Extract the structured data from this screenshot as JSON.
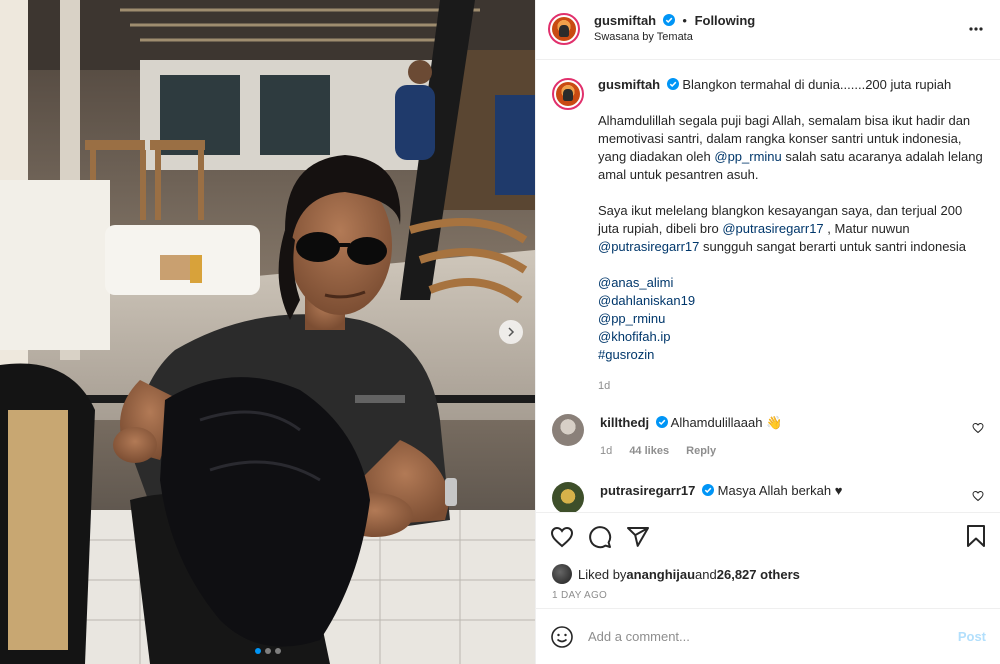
{
  "header": {
    "username": "gusmiftah",
    "separator": "•",
    "follow_status": "Following",
    "location": "Swasana by Temata",
    "more_icon": "more-horizontal-icon"
  },
  "caption": {
    "username": "gusmiftah",
    "title": "Blangkon termahal di dunia.......200 juta rupiah",
    "para1": "Alhamdulillah segala puji bagi Allah, semalam bisa ikut hadir dan memotivasi santri, dalam rangka konser santri untuk indonesia, yang diadakan oleh ",
    "para1_mention": "@pp_rminu",
    "para1_end": " salah satu acaranya adalah lelang amal untuk pesantren asuh.",
    "para2": "Saya ikut melelang blangkon kesayangan saya, dan terjual 200 juta rupiah, dibeli bro ",
    "para2_mention1": "@putrasiregarr17",
    "para2_mid": " , Matur nuwun ",
    "para2_mention2": "@putrasiregarr17",
    "para2_end": " sungguh sangat berarti untuk santri indonesia",
    "tags": [
      "@anas_alimi",
      "@dahlaniskan19",
      "@pp_rminu",
      "@khofifah.ip",
      "#gusrozin"
    ],
    "time": "1d"
  },
  "comments": [
    {
      "username": "killthedj",
      "text": "Alhamdulillaaah 👋",
      "time": "1d",
      "likes": "44 likes",
      "reply": "Reply"
    },
    {
      "username": "putrasiregarr17",
      "text": "Masya Allah berkah ♥"
    }
  ],
  "likes": {
    "prefix": "Liked by ",
    "user": "ananghijau",
    "middle": " and ",
    "count": "26,827 others"
  },
  "date": "1 DAY AGO",
  "add_comment": {
    "placeholder": "Add a comment...",
    "post_label": "Post"
  },
  "colors": {
    "link": "#00376b",
    "verified": "#0095f6",
    "muted": "#8e8e8e",
    "post_disabled": "#b2dffc"
  }
}
